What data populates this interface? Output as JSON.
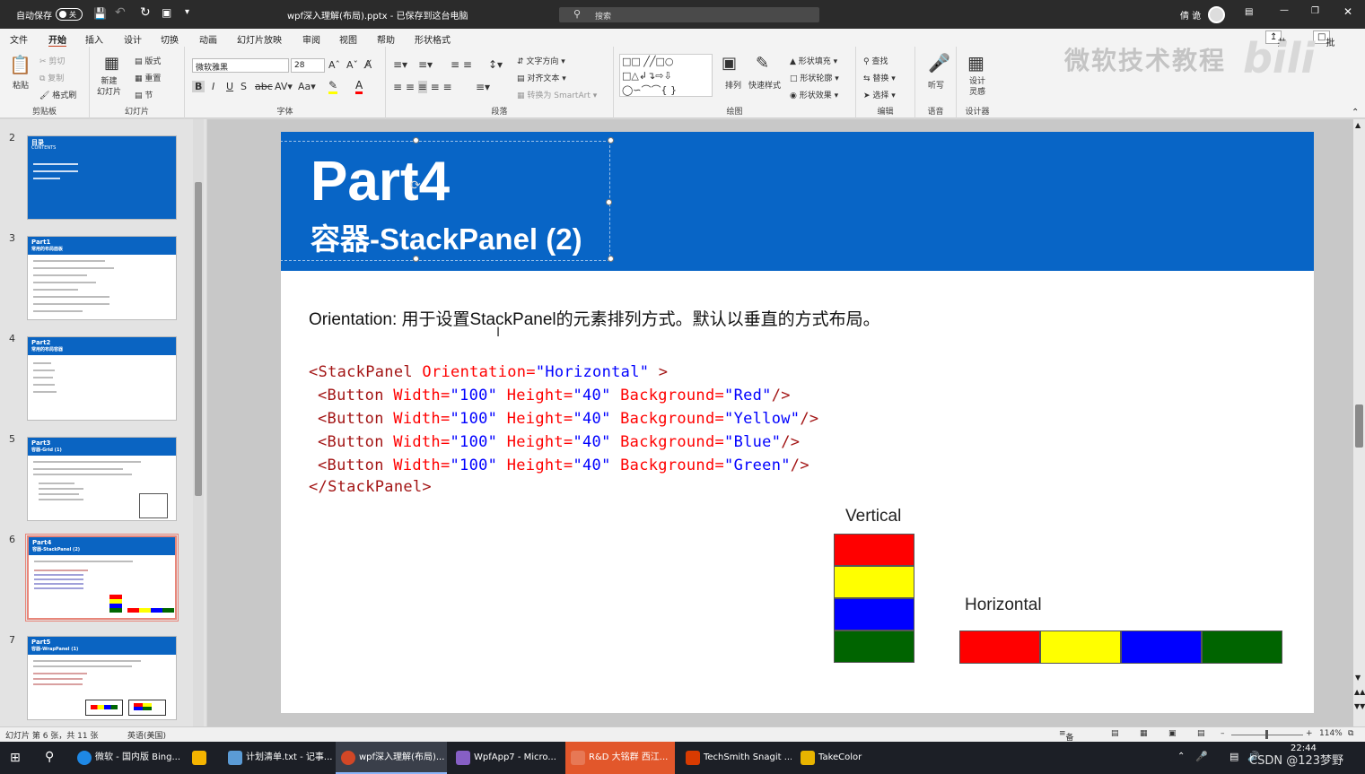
{
  "titlebar": {
    "autosave": "自动保存",
    "autosave_state": "关",
    "doc_title": "wpf深入理解(布局).pptx - 已保存到这台电脑",
    "search_placeholder": "搜索",
    "user": "倩 诡"
  },
  "menu": [
    "文件",
    "开始",
    "插入",
    "设计",
    "切换",
    "动画",
    "幻灯片放映",
    "审阅",
    "视图",
    "帮助",
    "形状格式"
  ],
  "menu_active": "开始",
  "share_label": "共享",
  "comment_label": "批注",
  "watermark": "微软技术教程",
  "ribbon": {
    "clipboard": {
      "paste": "粘贴",
      "cut": "剪切",
      "copy": "复制",
      "format_painter": "格式刷",
      "label": "剪贴板"
    },
    "slides": {
      "new_slide": "新建\n幻灯片",
      "layout": "版式",
      "reset": "重置",
      "section": "节",
      "label": "幻灯片"
    },
    "font": {
      "font_name": "微软雅黑",
      "font_size": "28",
      "label": "字体"
    },
    "paragraph": {
      "text_direction": "文字方向",
      "align_text": "对齐文本",
      "smartart": "转换为 SmartArt",
      "label": "段落"
    },
    "drawing": {
      "arrange": "排列",
      "quick_styles": "快速样式",
      "fill": "形状填充",
      "outline": "形状轮廓",
      "effects": "形状效果",
      "label": "绘图"
    },
    "editing": {
      "find": "查找",
      "replace": "替换",
      "select": "选择",
      "label": "编辑"
    },
    "voice": {
      "dictate": "听写",
      "label": "语音"
    },
    "designer": {
      "design_ideas": "设计\n灵感",
      "label": "设计器"
    }
  },
  "thumbnails": [
    {
      "num": "2",
      "title": "目录",
      "subtitle": "CONTENTS"
    },
    {
      "num": "3",
      "title": "Part1",
      "subtitle": "常用的布局面板"
    },
    {
      "num": "4",
      "title": "Part2",
      "subtitle": "常用的布局容器"
    },
    {
      "num": "5",
      "title": "Part3",
      "subtitle": "容器-Grid (1)"
    },
    {
      "num": "6",
      "title": "Part4",
      "subtitle": "容器-StackPanel (2)"
    },
    {
      "num": "7",
      "title": "Part5",
      "subtitle": "容器-WrapPanel (1)"
    }
  ],
  "slide": {
    "title": "Part4",
    "subtitle": "容器-StackPanel (2)",
    "description": "Orientation: 用于设置StackPanel的元素排列方式。默认以垂直的方式布局。",
    "code": {
      "open_tag": "<StackPanel",
      "open_attr": " Orientation=",
      "open_val": "\"Horizontal\"",
      "open_end": " >",
      "buttons": [
        {
          "bg": "\"Red\""
        },
        {
          "bg": "\"Yellow\""
        },
        {
          "bg": "\"Blue\""
        },
        {
          "bg": "\"Green\""
        }
      ],
      "btn_tag": "<Button",
      "width_attr": " Width=",
      "width_val": "\"100\"",
      "height_attr": " Height=",
      "height_val": "\"40\"",
      "bg_attr": " Background=",
      "btn_end": "/>",
      "close_tag": "</StackPanel>"
    },
    "vertical_label": "Vertical",
    "horizontal_label": "Horizontal",
    "colors": [
      "#ff0000",
      "#ffff00",
      "#0000ff",
      "#006400"
    ]
  },
  "status": {
    "slide_info": "幻灯片 第 6 张，共 11 张",
    "language": "英语(美国)",
    "notes": "备注",
    "zoom": "114%"
  },
  "taskbar": [
    {
      "label": "微软 - 国内版 Bing...",
      "color": "#1e88e5"
    },
    {
      "label": "",
      "color": "#f4b400"
    },
    {
      "label": "计划清单.txt - 记事...",
      "color": "#5b9bd5"
    },
    {
      "label": "wpf深入理解(布局)...",
      "color": "#d24726"
    },
    {
      "label": "WpfApp7 - Micro...",
      "color": "#865fc5"
    },
    {
      "label": "R&D 大铭群 西江...",
      "color": "#e2572b"
    },
    {
      "label": "TechSmith Snagit ...",
      "color": "#d83b01"
    },
    {
      "label": "TakeColor",
      "color": "#e8b400"
    }
  ],
  "clock": {
    "time": "22:44",
    "overlay": "CSDN @123梦野"
  }
}
